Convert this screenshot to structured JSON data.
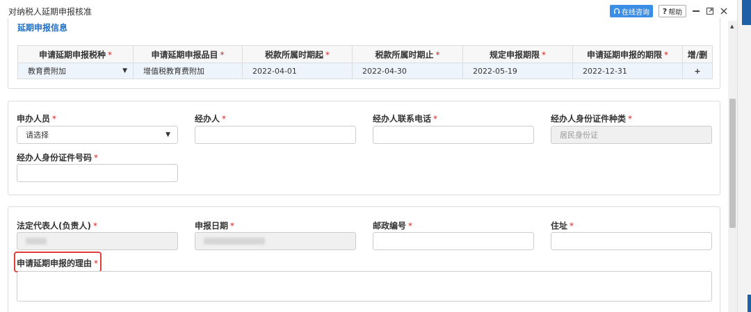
{
  "window": {
    "title": "对纳税人延期申报核准",
    "consult_label": "在线咨询",
    "help_label": "帮助"
  },
  "delay_section": {
    "title": "延期申报信息",
    "columns": [
      "申请延期申报税种",
      "申请延期申报品目",
      "税款所属时期起",
      "税款所属时期止",
      "规定申报期限",
      "申请延期申报的期限",
      "增/删"
    ],
    "required_marker": "*",
    "row": {
      "tax_type": "教育费附加",
      "item": "增值税教育费附加",
      "period_start": "2022-04-01",
      "period_end": "2022-04-30",
      "deadline": "2022-05-19",
      "delay_deadline": "2022-12-31",
      "add_symbol": "+"
    }
  },
  "handler_section": {
    "handler_person_label": "申办人员",
    "handler_person_value": "请选择",
    "agent_label": "经办人",
    "agent_phone_label": "经办人联系电话",
    "agent_id_type_label": "经办人身份证件种类",
    "agent_id_type_value": "居民身份证",
    "agent_id_number_label": "经办人身份证件号码"
  },
  "legal_section": {
    "legal_rep_label": "法定代表人(负责人)",
    "report_date_label": "申报日期",
    "postal_code_label": "邮政编号",
    "address_label": "住址",
    "reason_label": "申请延期申报的理由"
  },
  "colors": {
    "accent": "#1f6fc5",
    "required": "#e02020",
    "highlight": "#e23b3b"
  }
}
